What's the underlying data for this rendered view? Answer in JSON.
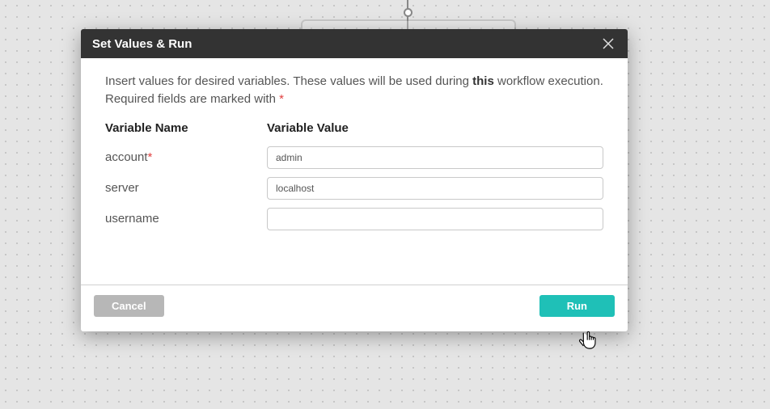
{
  "modal": {
    "title": "Set Values & Run",
    "description_prefix": "Insert values for desired variables. These values will be used during ",
    "description_bold": "this",
    "description_suffix": " workflow execution. Required fields are marked with ",
    "required_mark": "*",
    "column_name_label": "Variable Name",
    "column_value_label": "Variable Value",
    "variables": [
      {
        "name": "account",
        "required": true,
        "value": "admin"
      },
      {
        "name": "server",
        "required": false,
        "value": "localhost"
      },
      {
        "name": "username",
        "required": false,
        "value": ""
      }
    ],
    "cancel_label": "Cancel",
    "run_label": "Run"
  }
}
